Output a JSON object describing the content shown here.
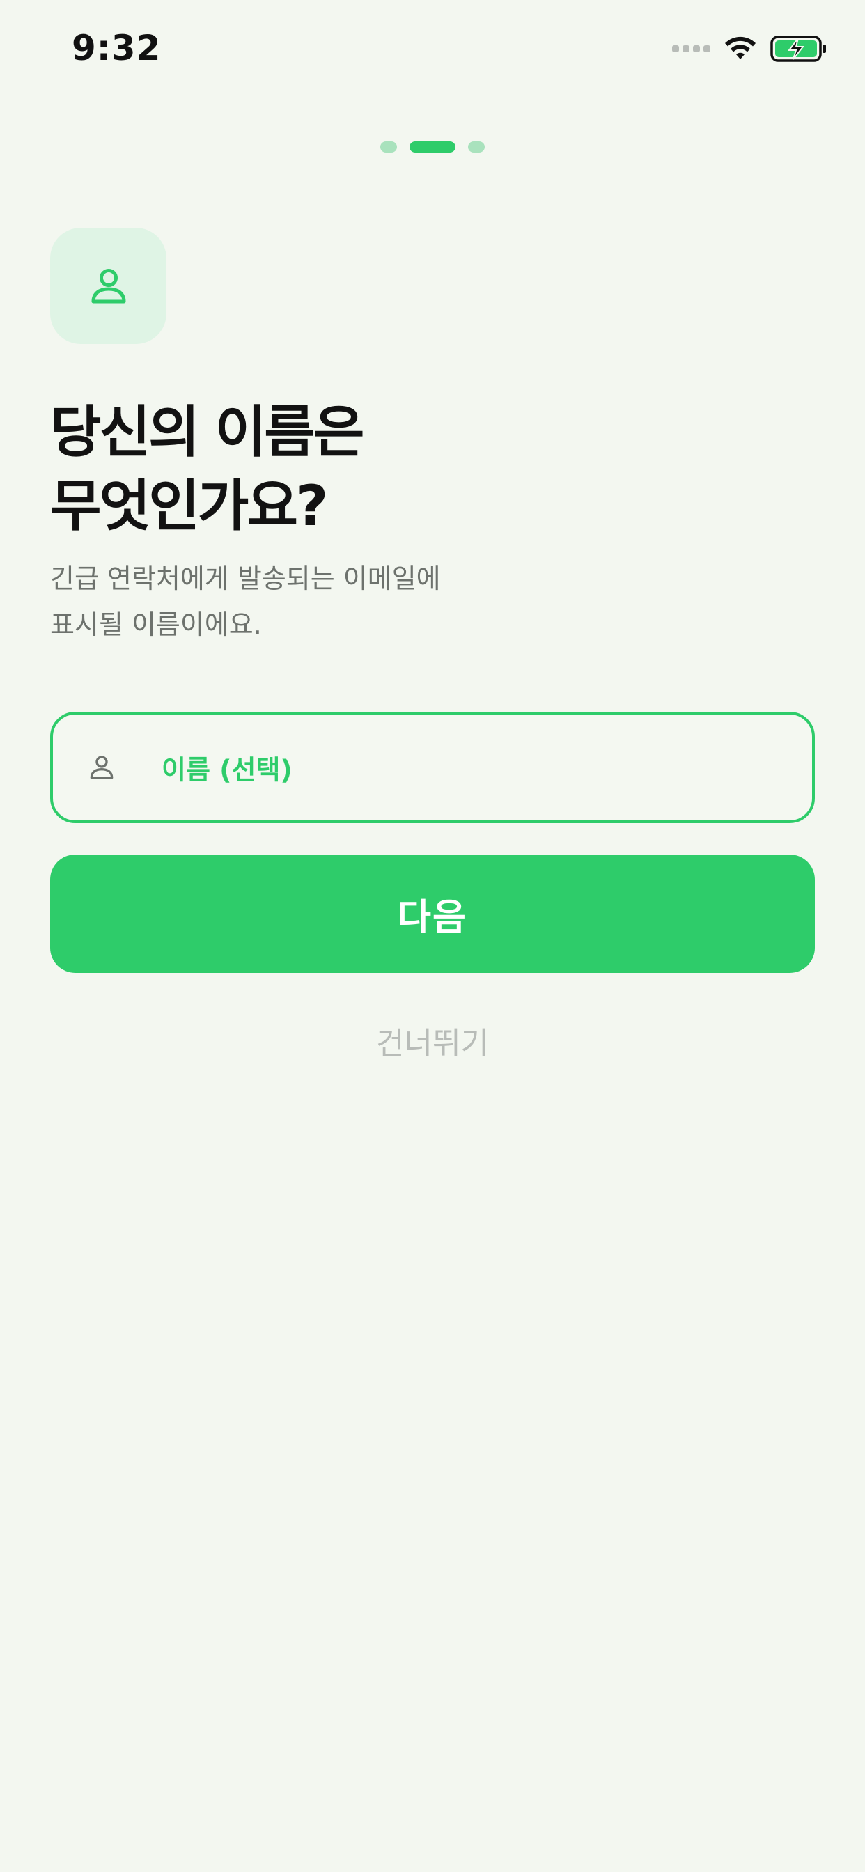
{
  "status_bar": {
    "time": "9:32"
  },
  "pager": {
    "total": 3,
    "active_index": 1
  },
  "header": {
    "icon": "person-icon",
    "title_line1": "당신의 이름은",
    "title_line2": "무엇인가요?",
    "subtitle_line1": "긴급 연락처에게 발송되는 이메일에",
    "subtitle_line2": "표시될 이름이에요."
  },
  "name_input": {
    "placeholder": "이름 (선택)",
    "value": "",
    "icon": "person-icon"
  },
  "actions": {
    "next_label": "다음",
    "skip_label": "건너뛰기"
  },
  "colors": {
    "accent": "#2ecc6a",
    "accent_light": "#a9e2bd",
    "tile_bg": "#dff4e5",
    "background": "#f3f7f0",
    "title_text": "#121212",
    "subtitle_text": "#6d726d",
    "skip_text": "#b8bcb8"
  }
}
